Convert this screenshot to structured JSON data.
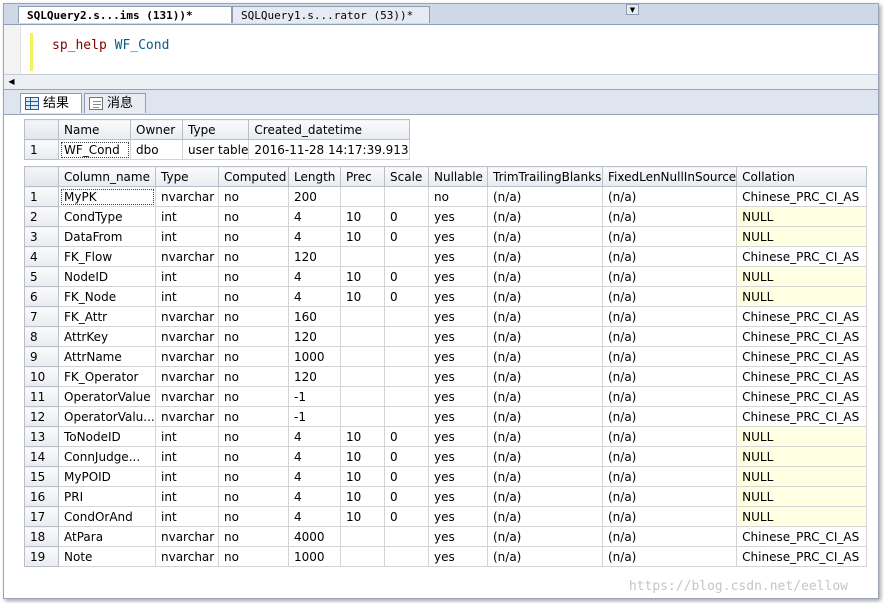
{
  "doc_tabs": [
    {
      "label": "SQLQuery2.s...ims (131))*",
      "active": true
    },
    {
      "label": "SQLQuery1.s...rator (53))*",
      "active": false
    }
  ],
  "editor": {
    "proc": "sp_help",
    "object": "WF_Cond"
  },
  "result_tabs": [
    {
      "label": "结果",
      "icon": "grid-icon"
    },
    {
      "label": "消息",
      "icon": "message-icon"
    }
  ],
  "object_table": {
    "columns": [
      "Name",
      "Owner",
      "Type",
      "Created_datetime"
    ],
    "rows": [
      {
        "n": "1",
        "cells": [
          "WF_Cond",
          "dbo",
          "user table",
          "2016-11-28 14:17:39.913"
        ]
      }
    ]
  },
  "column_table": {
    "columns": [
      "Column_name",
      "Type",
      "Computed",
      "Length",
      "Prec",
      "Scale",
      "Nullable",
      "TrimTrailingBlanks",
      "FixedLenNullInSource",
      "Collation"
    ],
    "rows": [
      {
        "n": "1",
        "cells": [
          "MyPK",
          "nvarchar",
          "no",
          "200",
          "",
          "",
          "no",
          "(n/a)",
          "(n/a)",
          "Chinese_PRC_CI_AS"
        ]
      },
      {
        "n": "2",
        "cells": [
          "CondType",
          "int",
          "no",
          "4",
          "10",
          "0",
          "yes",
          "(n/a)",
          "(n/a)",
          "NULL"
        ]
      },
      {
        "n": "3",
        "cells": [
          "DataFrom",
          "int",
          "no",
          "4",
          "10",
          "0",
          "yes",
          "(n/a)",
          "(n/a)",
          "NULL"
        ]
      },
      {
        "n": "4",
        "cells": [
          "FK_Flow",
          "nvarchar",
          "no",
          "120",
          "",
          "",
          "yes",
          "(n/a)",
          "(n/a)",
          "Chinese_PRC_CI_AS"
        ]
      },
      {
        "n": "5",
        "cells": [
          "NodeID",
          "int",
          "no",
          "4",
          "10",
          "0",
          "yes",
          "(n/a)",
          "(n/a)",
          "NULL"
        ]
      },
      {
        "n": "6",
        "cells": [
          "FK_Node",
          "int",
          "no",
          "4",
          "10",
          "0",
          "yes",
          "(n/a)",
          "(n/a)",
          "NULL"
        ]
      },
      {
        "n": "7",
        "cells": [
          "FK_Attr",
          "nvarchar",
          "no",
          "160",
          "",
          "",
          "yes",
          "(n/a)",
          "(n/a)",
          "Chinese_PRC_CI_AS"
        ]
      },
      {
        "n": "8",
        "cells": [
          "AttrKey",
          "nvarchar",
          "no",
          "120",
          "",
          "",
          "yes",
          "(n/a)",
          "(n/a)",
          "Chinese_PRC_CI_AS"
        ]
      },
      {
        "n": "9",
        "cells": [
          "AttrName",
          "nvarchar",
          "no",
          "1000",
          "",
          "",
          "yes",
          "(n/a)",
          "(n/a)",
          "Chinese_PRC_CI_AS"
        ]
      },
      {
        "n": "10",
        "cells": [
          "FK_Operator",
          "nvarchar",
          "no",
          "120",
          "",
          "",
          "yes",
          "(n/a)",
          "(n/a)",
          "Chinese_PRC_CI_AS"
        ]
      },
      {
        "n": "11",
        "cells": [
          "OperatorValue",
          "nvarchar",
          "no",
          "-1",
          "",
          "",
          "yes",
          "(n/a)",
          "(n/a)",
          "Chinese_PRC_CI_AS"
        ]
      },
      {
        "n": "12",
        "cells": [
          "OperatorValu...",
          "nvarchar",
          "no",
          "-1",
          "",
          "",
          "yes",
          "(n/a)",
          "(n/a)",
          "Chinese_PRC_CI_AS"
        ]
      },
      {
        "n": "13",
        "cells": [
          "ToNodeID",
          "int",
          "no",
          "4",
          "10",
          "0",
          "yes",
          "(n/a)",
          "(n/a)",
          "NULL"
        ]
      },
      {
        "n": "14",
        "cells": [
          "ConnJudge...",
          "int",
          "no",
          "4",
          "10",
          "0",
          "yes",
          "(n/a)",
          "(n/a)",
          "NULL"
        ]
      },
      {
        "n": "15",
        "cells": [
          "MyPOID",
          "int",
          "no",
          "4",
          "10",
          "0",
          "yes",
          "(n/a)",
          "(n/a)",
          "NULL"
        ]
      },
      {
        "n": "16",
        "cells": [
          "PRI",
          "int",
          "no",
          "4",
          "10",
          "0",
          "yes",
          "(n/a)",
          "(n/a)",
          "NULL"
        ]
      },
      {
        "n": "17",
        "cells": [
          "CondOrAnd",
          "int",
          "no",
          "4",
          "10",
          "0",
          "yes",
          "(n/a)",
          "(n/a)",
          "NULL"
        ]
      },
      {
        "n": "18",
        "cells": [
          "AtPara",
          "nvarchar",
          "no",
          "4000",
          "",
          "",
          "yes",
          "(n/a)",
          "(n/a)",
          "Chinese_PRC_CI_AS"
        ]
      },
      {
        "n": "19",
        "cells": [
          "Note",
          "nvarchar",
          "no",
          "1000",
          "",
          "",
          "yes",
          "(n/a)",
          "(n/a)",
          "Chinese_PRC_CI_AS"
        ]
      }
    ]
  },
  "watermark": "https://blog.csdn.net/eellow",
  "colors": {
    "null_cell": "#ffffe1",
    "editor_margin": "#f2f25c",
    "proc_keyword": "#800000"
  }
}
